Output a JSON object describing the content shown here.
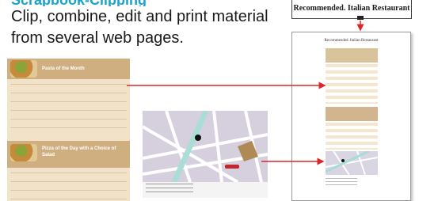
{
  "header": {
    "heading": "Scrapbook-Clipping",
    "intro": "Clip, combine, edit and print material from several web pages."
  },
  "caption_box": {
    "label": "Recommended. Italian Restaurant"
  },
  "menu_page": {
    "section1_title": "Pasta of the Month",
    "section2_title": "Pizza of the Day with a Choice of Salad"
  },
  "print_page": {
    "title": "Recommended. Italian Restaurant"
  },
  "colors": {
    "heading": "#1aa3c8",
    "arrow": "#d9262b",
    "menu_band": "#cfae80",
    "menu_bg": "#f1e2c8"
  }
}
